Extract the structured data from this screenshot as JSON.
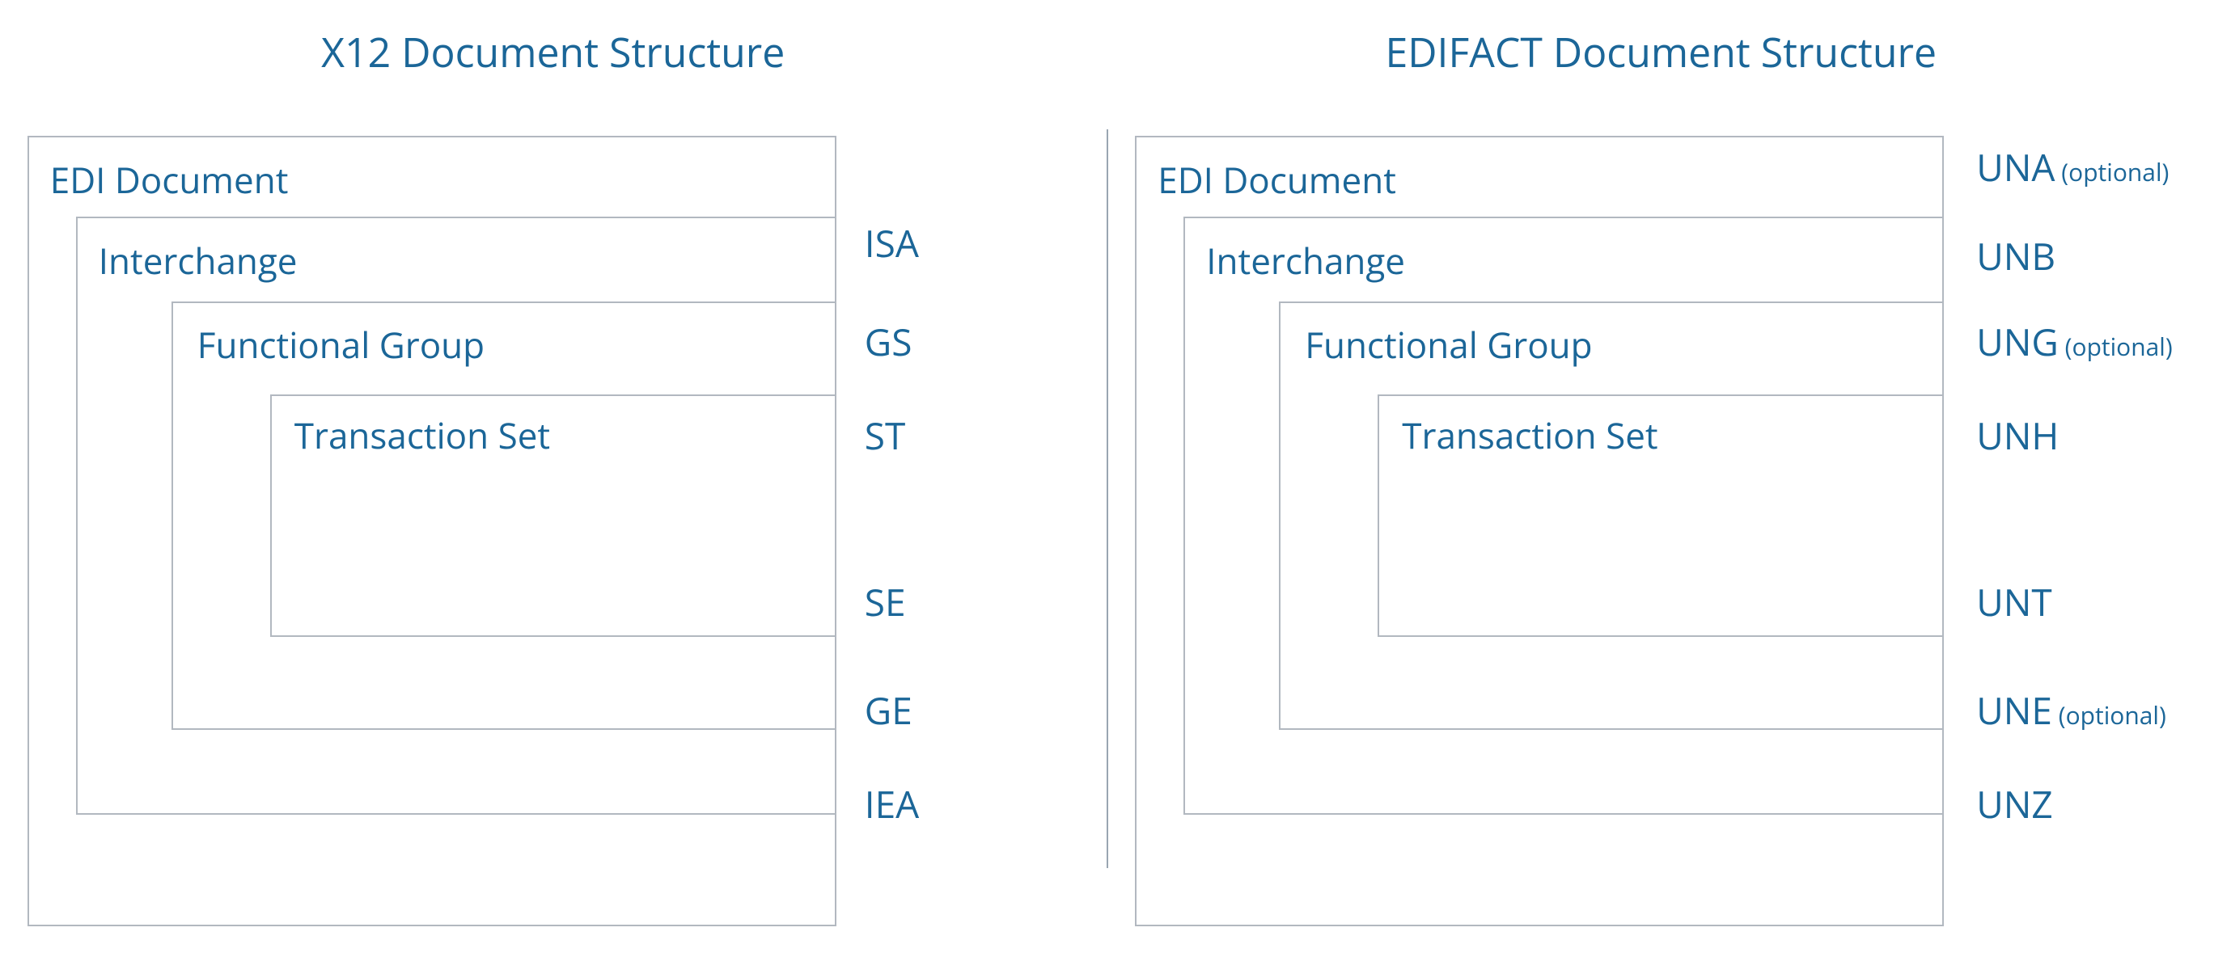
{
  "x12": {
    "title": "X12 Document Structure",
    "boxes": {
      "doc": "EDI Document",
      "interchange": "Interchange",
      "group": "Functional Group",
      "tset": "Transaction Set"
    },
    "segments": {
      "isa": "ISA",
      "gs": "GS",
      "st": "ST",
      "se": "SE",
      "ge": "GE",
      "iea": "IEA"
    }
  },
  "edifact": {
    "title": "EDIFACT Document Structure",
    "boxes": {
      "doc": "EDI Document",
      "interchange": "Interchange",
      "group": "Functional Group",
      "tset": "Transaction Set"
    },
    "segments": {
      "una": "UNA",
      "una_opt": " (optional)",
      "unb": "UNB",
      "ung": "UNG",
      "ung_opt": " (optional)",
      "unh": "UNH",
      "unt": "UNT",
      "une": "UNE",
      "une_opt": " (optional)",
      "unz": "UNZ"
    }
  }
}
